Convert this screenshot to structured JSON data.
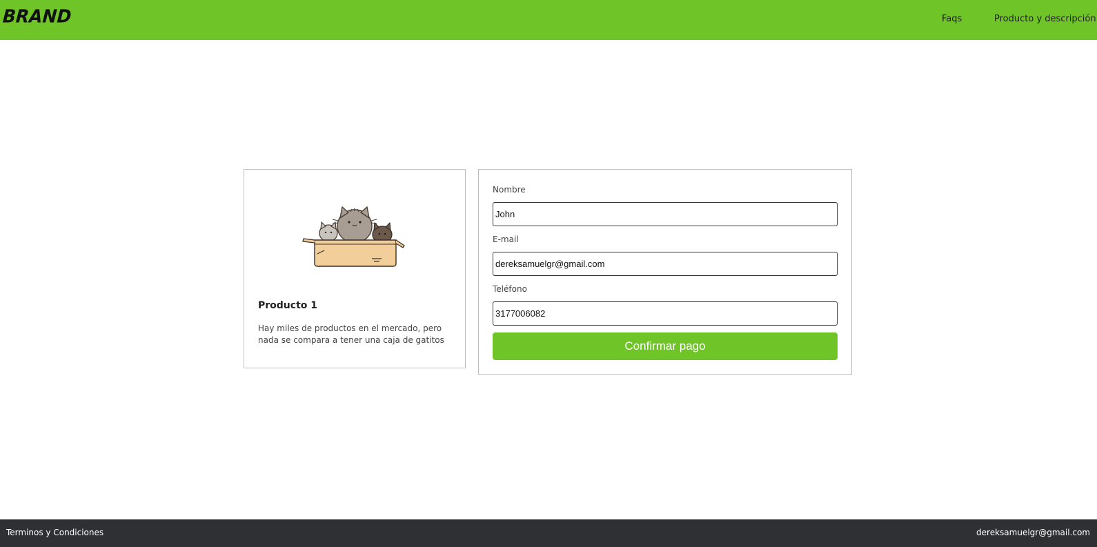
{
  "header": {
    "brand": "BRAND",
    "nav": [
      {
        "label": "Faqs"
      },
      {
        "label": "Producto y descripción"
      }
    ],
    "background_color": "#6fc427"
  },
  "product": {
    "image_icon": "cats-in-box-illustration",
    "title": "Producto 1",
    "description": "Hay miles de productos en el mercado, pero nada se compara a tener una caja de gatitos"
  },
  "form": {
    "nombre": {
      "label": "Nombre",
      "value": "John"
    },
    "email": {
      "label": "E-mail",
      "value": "dereksamuelgr@gmail.com"
    },
    "telefono": {
      "label": "Teléfono",
      "value": "3177006082"
    },
    "submit_label": "Confirmar pago",
    "button_color": "#6fc427"
  },
  "footer": {
    "left_link": "Terminos y Condiciones",
    "contact_email": "dereksamuelgr@gmail.com",
    "background_color": "#2f3033"
  }
}
